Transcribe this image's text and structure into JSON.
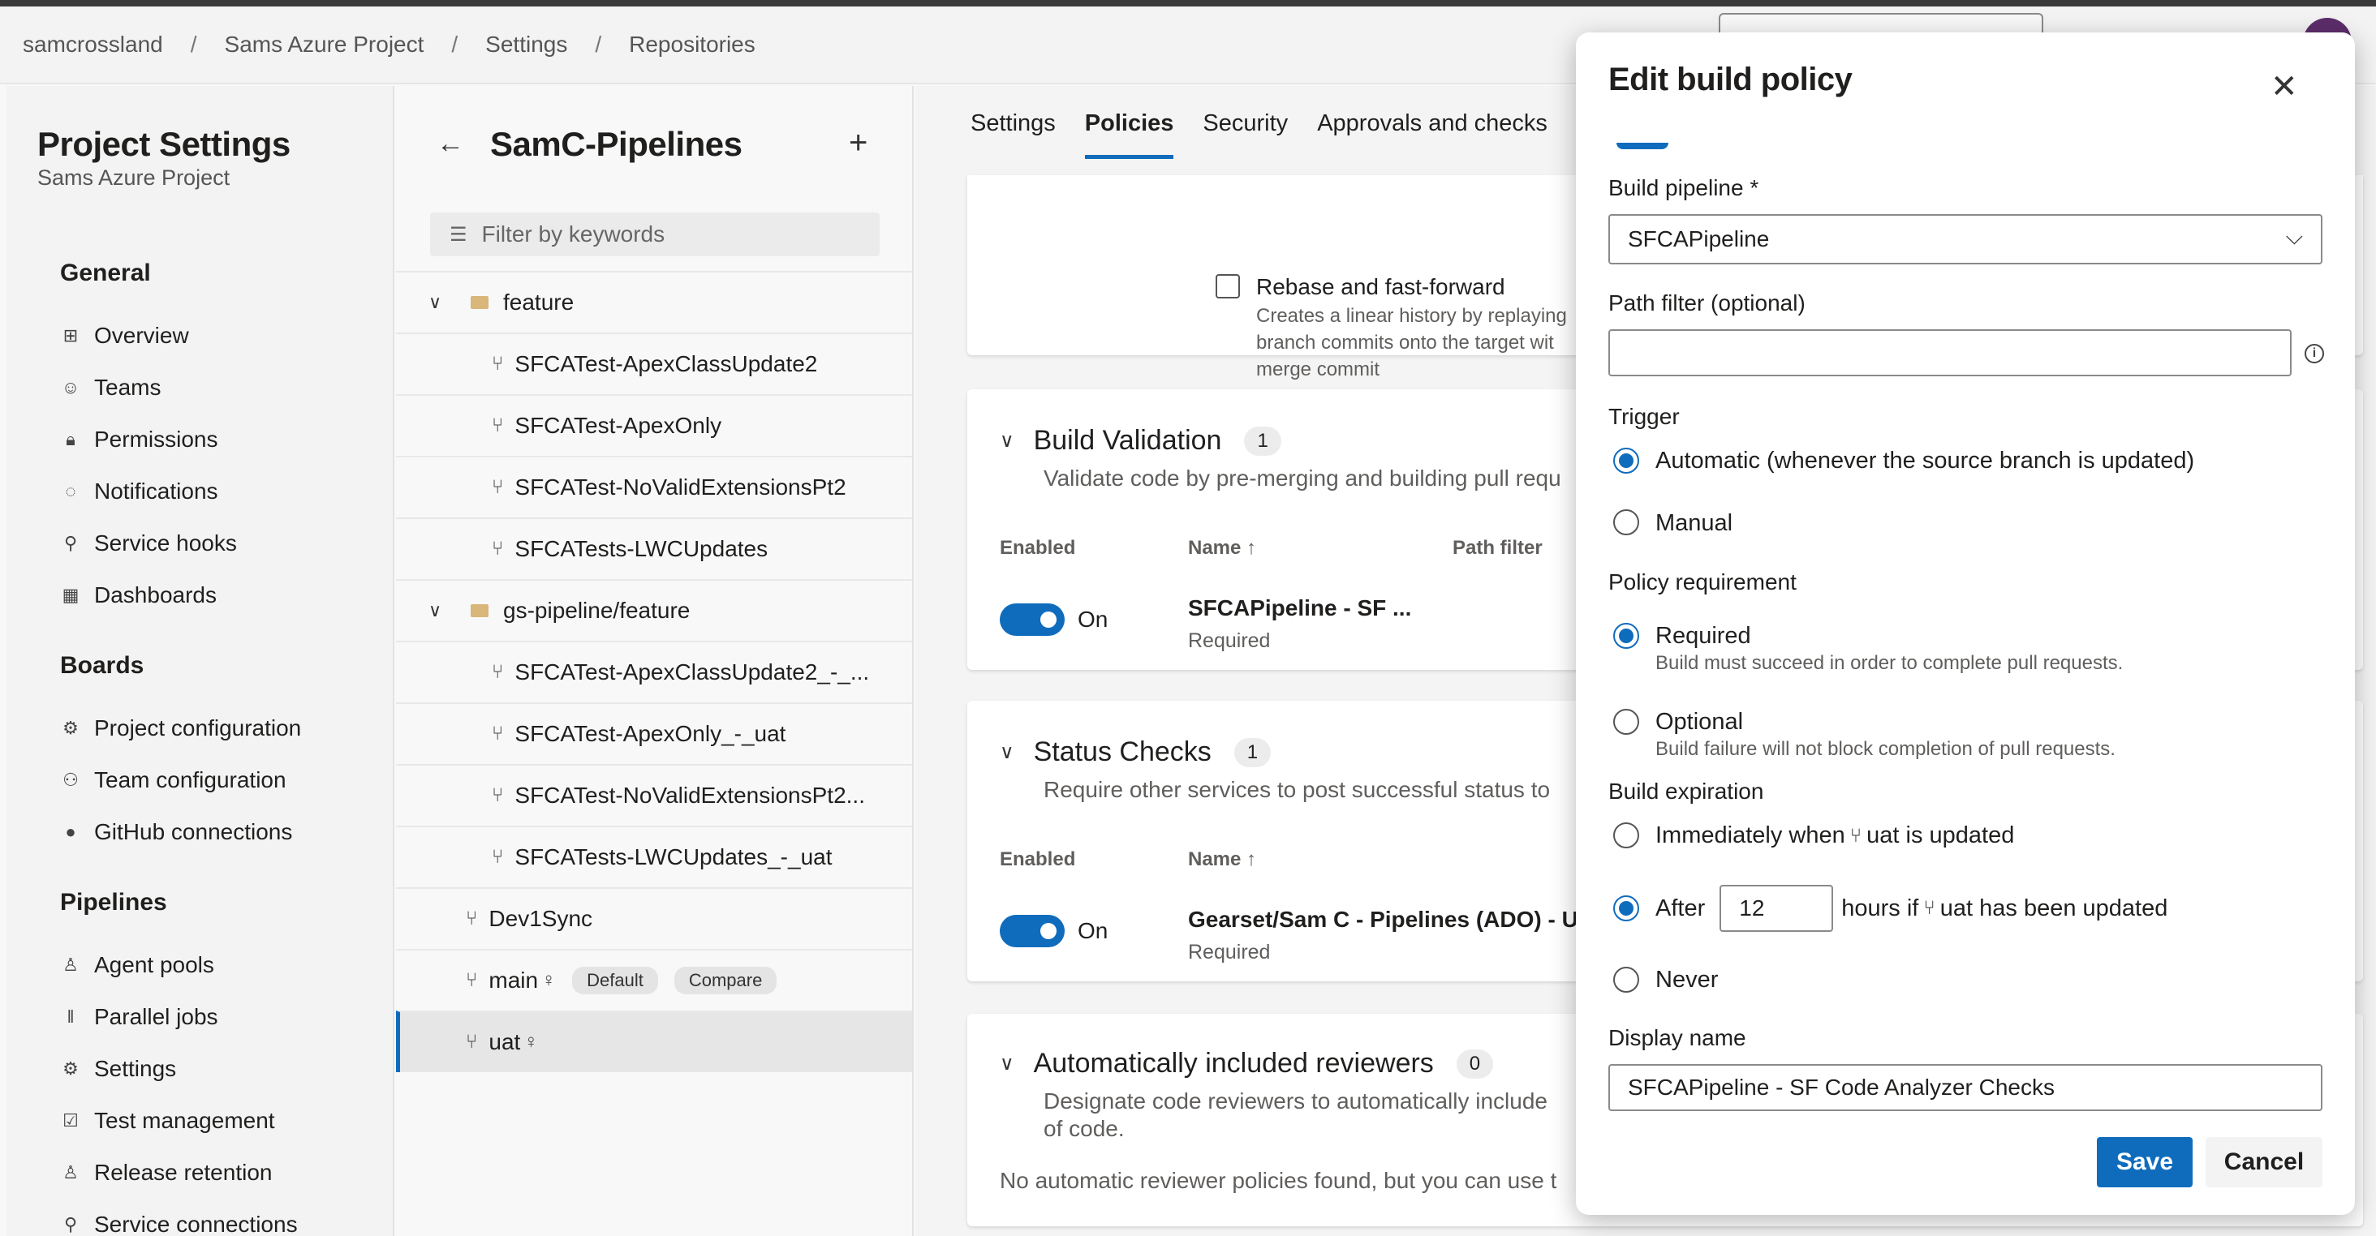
{
  "breadcrumb": [
    "samcrossland",
    "Sams Azure Project",
    "Settings",
    "Repositories"
  ],
  "project_settings": {
    "title": "Project Settings",
    "subtitle": "Sams Azure Project"
  },
  "nav": {
    "general": "General",
    "general_items": [
      "Overview",
      "Teams",
      "Permissions",
      "Notifications",
      "Service hooks",
      "Dashboards"
    ],
    "boards": "Boards",
    "boards_items": [
      "Project configuration",
      "Team configuration",
      "GitHub connections"
    ],
    "pipelines": "Pipelines",
    "pipelines_items": [
      "Agent pools",
      "Parallel jobs",
      "Settings",
      "Test management",
      "Release retention",
      "Service connections"
    ]
  },
  "branches": {
    "title": "SamC-Pipelines",
    "filter_placeholder": "Filter by keywords",
    "rows": [
      {
        "label": "feature",
        "kind": "folder"
      },
      {
        "label": "SFCATest-ApexClassUpdate2",
        "kind": "branch"
      },
      {
        "label": "SFCATest-ApexOnly",
        "kind": "branch"
      },
      {
        "label": "SFCATest-NoValidExtensionsPt2",
        "kind": "branch"
      },
      {
        "label": "SFCATests-LWCUpdates",
        "kind": "branch"
      },
      {
        "label": "gs-pipeline/feature",
        "kind": "folder"
      },
      {
        "label": "SFCATest-ApexClassUpdate2_-_...",
        "kind": "branch"
      },
      {
        "label": "SFCATest-ApexOnly_-_uat",
        "kind": "branch"
      },
      {
        "label": "SFCATest-NoValidExtensionsPt2...",
        "kind": "branch"
      },
      {
        "label": "SFCATests-LWCUpdates_-_uat",
        "kind": "branch"
      },
      {
        "label": "Dev1Sync",
        "kind": "root"
      },
      {
        "label": "main",
        "kind": "root"
      },
      {
        "label": "uat",
        "kind": "root"
      }
    ],
    "tag_default": "Default",
    "tag_compare": "Compare"
  },
  "tabs": [
    "Settings",
    "Policies",
    "Security",
    "Approvals and checks"
  ],
  "merge_card": {
    "option": "Rebase and fast-forward",
    "desc1": "Creates a linear history by replaying",
    "desc2": "branch commits onto the target wit",
    "desc3": "merge commit"
  },
  "build_validation": {
    "title": "Build Validation",
    "count": "1",
    "desc": "Validate code by pre-merging and building pull requ",
    "col_enabled": "Enabled",
    "col_name": "Name",
    "col_path": "Path filter",
    "row_toggle": "On",
    "row_name": "SFCAPipeline - SF ...",
    "row_sub": "Required"
  },
  "status_checks": {
    "title": "Status Checks",
    "count": "1",
    "desc": "Require other services to post successful status to",
    "col_enabled": "Enabled",
    "col_name": "Name",
    "row_toggle": "On",
    "row_name": "Gearset/Sam C - Pipelines (ADO) - U",
    "row_sub": "Required"
  },
  "reviewers": {
    "title": "Automatically included reviewers",
    "count": "0",
    "desc1": "Designate code reviewers to automatically include",
    "desc2": "of code.",
    "empty": "No automatic reviewer policies found, but you can use t"
  },
  "panel": {
    "title": "Edit build policy",
    "build_pipeline_label": "Build pipeline *",
    "build_pipeline_value": "SFCAPipeline",
    "path_filter_label": "Path filter (optional)",
    "path_filter_value": "",
    "trigger_label": "Trigger",
    "trigger_automatic": "Automatic (whenever the source branch is updated)",
    "trigger_manual": "Manual",
    "policy_label": "Policy requirement",
    "required": "Required",
    "required_desc": "Build must succeed in order to complete pull requests.",
    "optional": "Optional",
    "optional_desc": "Build failure will not block completion of pull requests.",
    "expiration_label": "Build expiration",
    "immediately_prefix": "Immediately when",
    "immediately_branch": "uat is updated",
    "after_prefix": "After",
    "after_hours": "12",
    "after_mid": "hours if",
    "after_branch": "uat has been updated",
    "never": "Never",
    "display_name_label": "Display name",
    "display_name_value": "SFCAPipeline - SF Code Analyzer Checks",
    "save": "Save",
    "cancel": "Cancel"
  },
  "colors": {
    "accent": "#0f6cbd"
  }
}
